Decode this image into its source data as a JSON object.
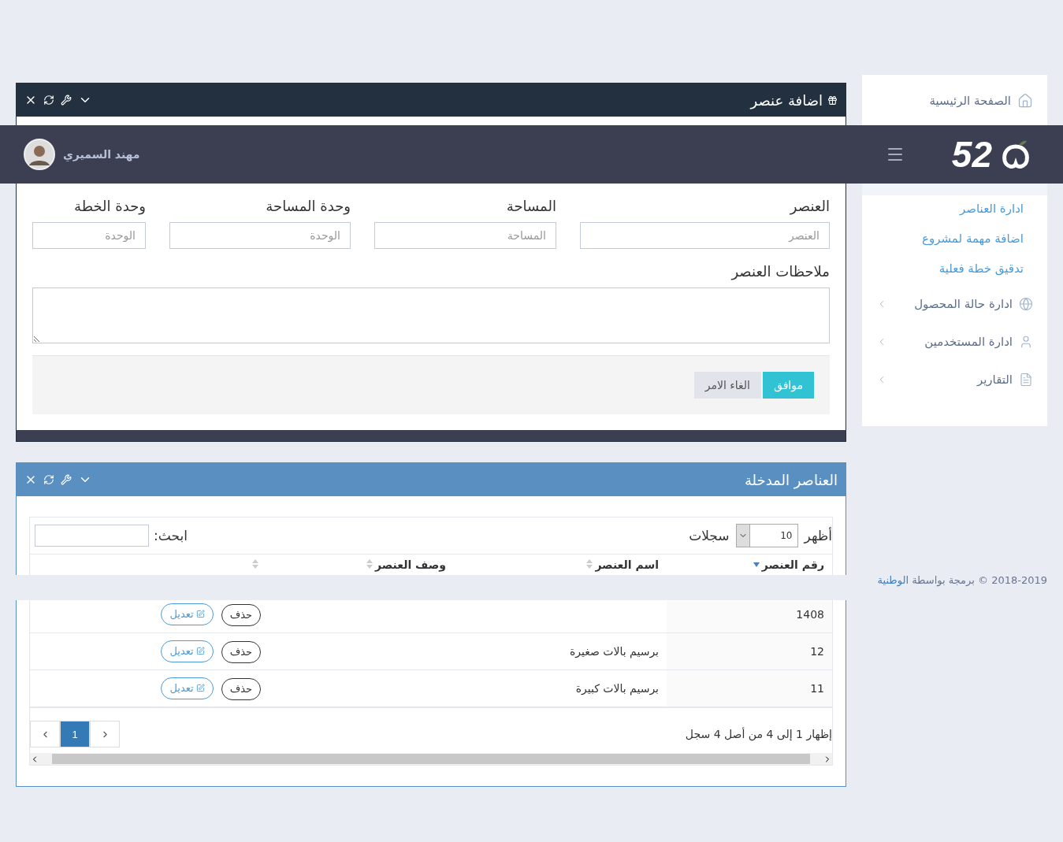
{
  "header": {
    "logo": "52",
    "user_name": "مهند السميري"
  },
  "sidebar": {
    "items": [
      {
        "kind": "top",
        "label": "الصفحة الرئيسية"
      },
      {
        "kind": "sub",
        "label": "ادارة العناصر"
      },
      {
        "kind": "sub",
        "label": "اضافة مهمة لمشروع"
      },
      {
        "kind": "sub",
        "label": "تدقيق خطة فعلية"
      },
      {
        "kind": "group",
        "label": "ادارة حالة المحصول"
      },
      {
        "kind": "group",
        "label": "ادارة المستخدمين"
      },
      {
        "kind": "group",
        "label": "التقارير"
      }
    ]
  },
  "form_panel": {
    "title": "اضافة عنصر",
    "fields": [
      {
        "label": "العنصر",
        "placeholder": "العنصر"
      },
      {
        "label": "المساحة",
        "placeholder": "المساحة"
      },
      {
        "label": "وحدة المساحة",
        "placeholder": "الوحدة"
      },
      {
        "label": "وحدة الخطة",
        "placeholder": "الوحدة"
      }
    ],
    "notes_label": "ملاحظات العنصر",
    "buttons": [
      {
        "label": "موافق",
        "kind": "primary"
      },
      {
        "label": "الغاء الامر",
        "kind": "default"
      }
    ]
  },
  "table_panel": {
    "title": "العناصر المدخلة",
    "length_prefix": "أظهر",
    "length_value": "10",
    "length_suffix": "سجلات",
    "search_label": "ابحث:",
    "columns": [
      {
        "label": "رقم العنصر",
        "sorted": true
      },
      {
        "label": "اسم العنصر",
        "sorted": false
      },
      {
        "label": "وصف العنصر",
        "sorted": false
      },
      {
        "sorted": false
      }
    ],
    "rows": [
      {
        "number": "1408",
        "delete": "حذف",
        "edit": "تعديل"
      },
      {
        "number": "12",
        "name": "برسيم بالات صغيرة",
        "delete": "حذف",
        "edit": "تعديل"
      },
      {
        "number": "11",
        "name": "برسيم بالات كبيرة",
        "delete": "حذف",
        "edit": "تعديل"
      }
    ],
    "info": "إظهار 1 إلى 4 من أصل 4 سجل",
    "pages": [
      {
        "label": "1",
        "selected": true
      }
    ]
  },
  "footer": {
    "text": "2018-2019 © برمجة بواسطة",
    "link": "الوطنية"
  }
}
